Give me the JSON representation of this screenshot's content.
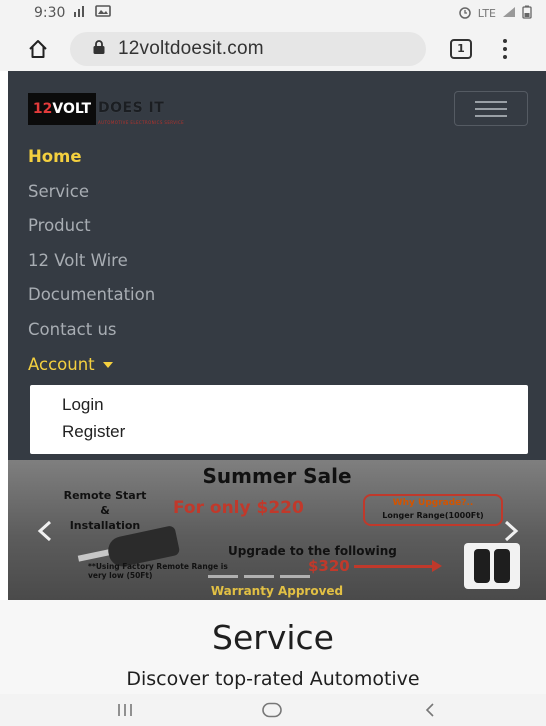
{
  "status_bar": {
    "time": "9:30",
    "network": "LTE"
  },
  "browser": {
    "url": "12voltdoesit.com",
    "tab_count": "1"
  },
  "site": {
    "logo": {
      "mark": "12VOLT",
      "does_it": "DOES IT",
      "tagline": "AUTOMOTIVE ELECTRONICS SERVICE"
    },
    "nav_items": [
      {
        "label": "Home",
        "active": true
      },
      {
        "label": "Service"
      },
      {
        "label": "Product"
      },
      {
        "label": "12 Volt Wire"
      },
      {
        "label": "Documentation"
      },
      {
        "label": "Contact us"
      },
      {
        "label": "Account"
      }
    ],
    "account_menu": [
      {
        "label": "Login"
      },
      {
        "label": "Register"
      }
    ]
  },
  "banner": {
    "title": "Summer Sale",
    "remote_start_lines": [
      "Remote Start",
      "&",
      "Installation"
    ],
    "offer": "For only $220",
    "why_upgrade": "Why Upgrade?..",
    "range": "Longer Range(1000Ft)",
    "upgrade_text": "Upgrade to the following",
    "upgrade_price": "$320",
    "footnote": "**Using Factory Remote Range is very low (50Ft)",
    "warranty": "Warranty Approved"
  },
  "service": {
    "title": "Service",
    "subtitle": "Discover top-rated Automotive"
  },
  "colors": {
    "nav_bg": "#353b43",
    "accent_yellow": "#f4d03f",
    "nav_text": "#a8adb3",
    "sale_red": "#c0392b"
  }
}
